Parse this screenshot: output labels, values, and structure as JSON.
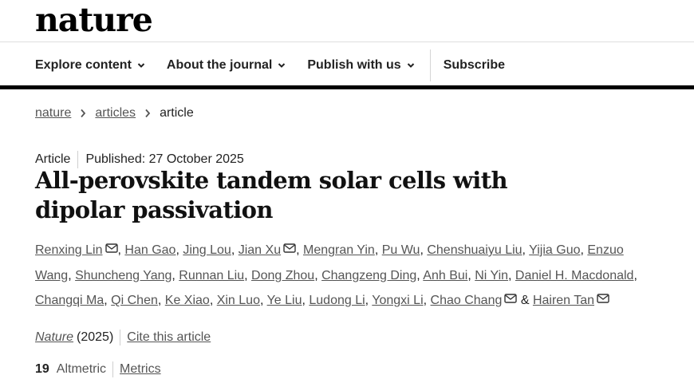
{
  "header": {
    "logo": "nature"
  },
  "nav": {
    "items": [
      {
        "label": "Explore content",
        "has_dropdown": true
      },
      {
        "label": "About the journal",
        "has_dropdown": true
      },
      {
        "label": "Publish with us",
        "has_dropdown": true
      }
    ],
    "subscribe": "Subscribe"
  },
  "breadcrumb": [
    "nature",
    "articles",
    "article"
  ],
  "article": {
    "type": "Article",
    "published": "Published: 27 October 2025",
    "title": "All-perovskite tandem solar cells with dipolar passivation",
    "authors": [
      {
        "name": "Renxing Lin",
        "sep": ", ",
        "email": true
      },
      {
        "name": "Han Gao",
        "sep": ", ",
        "email": false
      },
      {
        "name": "Jing Lou",
        "sep": ", ",
        "email": false
      },
      {
        "name": "Jian Xu",
        "sep": ", ",
        "email": true
      },
      {
        "name": "Mengran Yin",
        "sep": ", ",
        "email": false
      },
      {
        "name": "Pu Wu",
        "sep": ", ",
        "email": false
      },
      {
        "name": "Chenshuaiyu Liu",
        "sep": ", ",
        "email": false
      },
      {
        "name": "Yijia Guo",
        "sep": ", ",
        "email": false
      },
      {
        "name": "Enzuo Wang",
        "sep": ", ",
        "email": false
      },
      {
        "name": "Shuncheng Yang",
        "sep": ", ",
        "email": false
      },
      {
        "name": "Runnan Liu",
        "sep": ", ",
        "email": false
      },
      {
        "name": "Dong Zhou",
        "sep": ", ",
        "email": false
      },
      {
        "name": "Changzeng Ding",
        "sep": ", ",
        "email": false
      },
      {
        "name": "Anh Bui",
        "sep": ", ",
        "email": false
      },
      {
        "name": "Ni Yin",
        "sep": ", ",
        "email": false
      },
      {
        "name": "Daniel H. Macdonald",
        "sep": ", ",
        "email": false
      },
      {
        "name": "Changqi Ma",
        "sep": ", ",
        "email": false
      },
      {
        "name": "Qi Chen",
        "sep": ", ",
        "email": false
      },
      {
        "name": "Ke Xiao",
        "sep": ", ",
        "email": false
      },
      {
        "name": "Xin Luo",
        "sep": ", ",
        "email": false
      },
      {
        "name": "Ye Liu",
        "sep": ", ",
        "email": false
      },
      {
        "name": "Ludong Li",
        "sep": ", ",
        "email": false
      },
      {
        "name": "Yongxi Li",
        "sep": ", ",
        "email": false
      },
      {
        "name": "Chao Chang",
        "sep": " & ",
        "email": true
      },
      {
        "name": "Hairen Tan",
        "sep": "",
        "email": true
      }
    ],
    "journal_name": "Nature",
    "journal_year": "(2025)",
    "cite": "Cite this article",
    "altmetric_count": "19",
    "altmetric_label": "Altmetric",
    "metrics_link": "Metrics"
  },
  "colors": {
    "text": "#222222",
    "link": "#555555",
    "bar": "#000000"
  }
}
